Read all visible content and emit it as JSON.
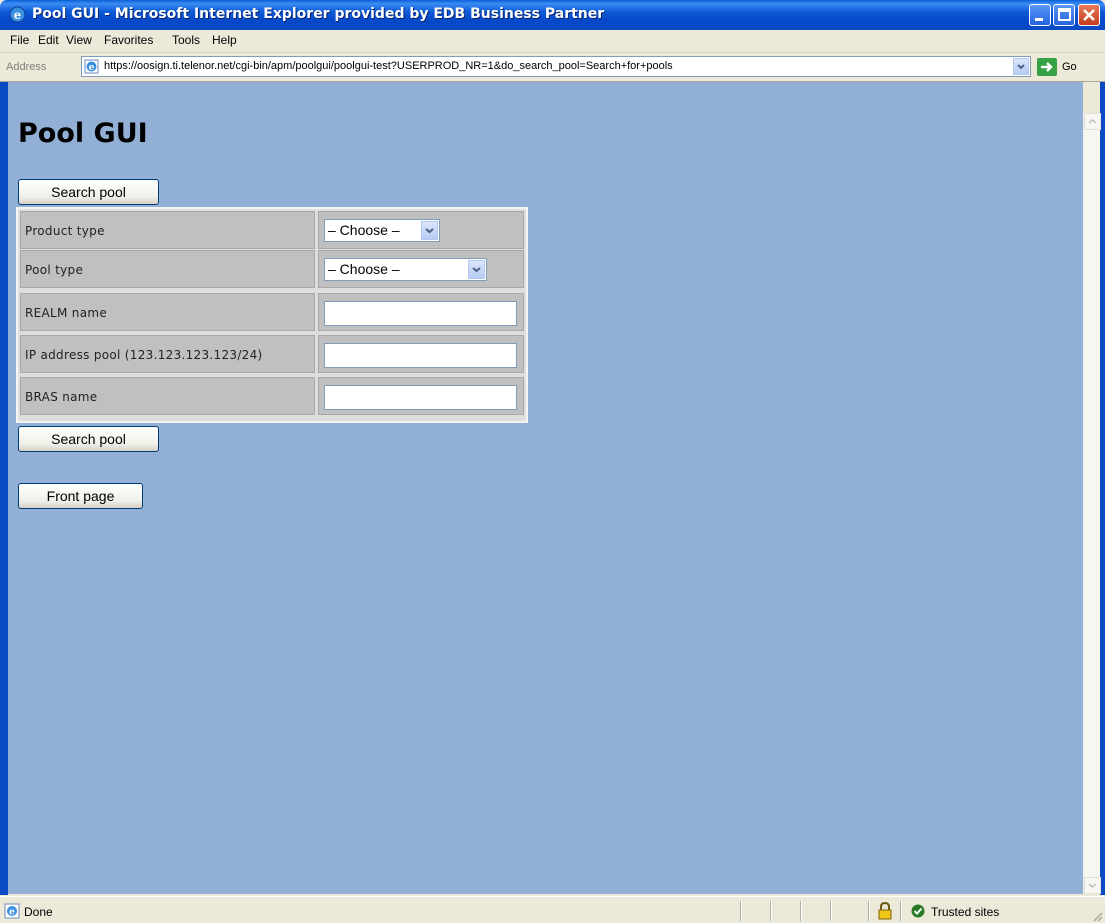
{
  "window": {
    "title": "Pool GUI - Microsoft Internet Explorer provided by EDB Business Partner"
  },
  "menu": {
    "file": "File",
    "edit": "Edit",
    "view": "View",
    "favorites": "Favorites",
    "tools": "Tools",
    "help": "Help"
  },
  "address": {
    "label": "Address",
    "url": "https://oosign.ti.telenor.net/cgi-bin/apm/poolgui/poolgui-test?USERPROD_NR=1&do_search_pool=Search+for+pools",
    "go": "Go"
  },
  "page": {
    "title": "Pool GUI",
    "search_button_top": "Search pool",
    "search_button_bottom": "Search pool",
    "front_page_button": "Front page",
    "fields": {
      "product_type": {
        "label": "Product type",
        "value": "– Choose –"
      },
      "pool_type": {
        "label": "Pool type",
        "value": "– Choose –"
      },
      "realm_name": {
        "label": "REALM name",
        "value": ""
      },
      "ip_pool": {
        "label": "IP address pool (123.123.123.123/24)",
        "value": ""
      },
      "bras_name": {
        "label": "BRAS name",
        "value": ""
      }
    }
  },
  "status": {
    "text": "Done",
    "zone": "Trusted sites"
  },
  "colors": {
    "titlebar": "#0a4bc4",
    "page_bg": "#92b0d5",
    "chrome": "#ece9d8"
  }
}
